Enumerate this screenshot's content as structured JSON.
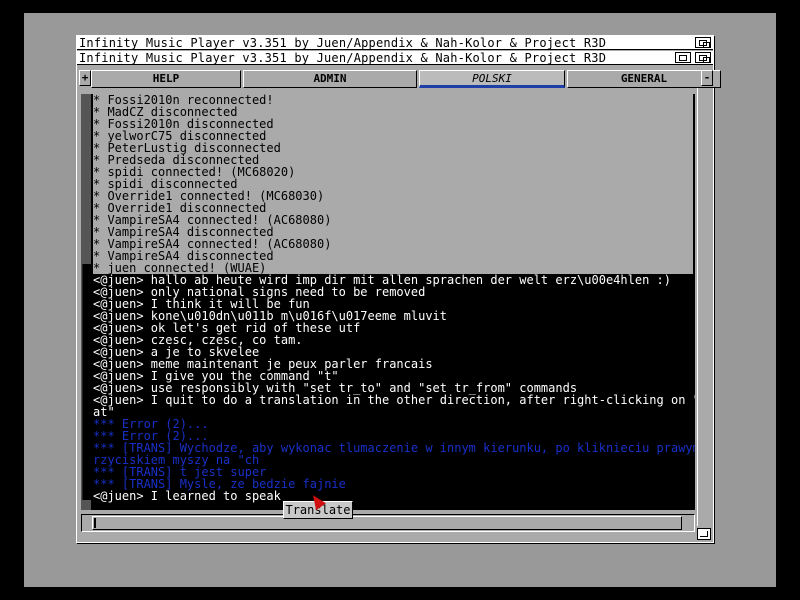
{
  "window": {
    "title": "Infinity Music Player v3.351 by Juen/Appendix & Nah-Kolor & Project R3D",
    "subtitle": "Infinity Music Player v3.351 by Juen/Appendix & Nah-Kolor & Project R3D"
  },
  "tabs": {
    "left_arrow": "+",
    "right_arrow": "-",
    "items": [
      {
        "label": "HELP"
      },
      {
        "label": "ADMIN"
      },
      {
        "label": "POLSKI"
      },
      {
        "label": "GENERAL"
      }
    ],
    "active": "POLSKI"
  },
  "log": {
    "lines": [
      {
        "text": "* Fossi2010n reconnected!",
        "kind": "sys"
      },
      {
        "text": "* MadCZ disconnected",
        "kind": "sys"
      },
      {
        "text": "* Fossi2010n disconnected",
        "kind": "sys"
      },
      {
        "text": "* yelworC75 disconnected",
        "kind": "sys"
      },
      {
        "text": "* PeterLustig disconnected",
        "kind": "sys"
      },
      {
        "text": "* Predseda disconnected",
        "kind": "sys"
      },
      {
        "text": "* spidi connected! (MC68020)",
        "kind": "sys"
      },
      {
        "text": "* spidi disconnected",
        "kind": "sys"
      },
      {
        "text": "* Override1 connected! (MC68030)",
        "kind": "sys"
      },
      {
        "text": "* Override1 disconnected",
        "kind": "sys"
      },
      {
        "text": "* VampireSA4 connected! (AC68080)",
        "kind": "sys"
      },
      {
        "text": "* VampireSA4 disconnected",
        "kind": "sys"
      },
      {
        "text": "* VampireSA4 connected! (AC68080)",
        "kind": "sys"
      },
      {
        "text": "* VampireSA4 disconnected",
        "kind": "sys"
      },
      {
        "text": "* juen connected! (WUAE)",
        "kind": "sys"
      },
      {
        "text": "<@juen> hallo ab heute wird imp dir mit allen sprachen der welt erz\\u00e4hlen :)",
        "kind": "user"
      },
      {
        "text": "<@juen> only national signs need to be removed",
        "kind": "user"
      },
      {
        "text": "<@juen> I think it will be fun",
        "kind": "user"
      },
      {
        "text": "<@juen> kone\\u010dn\\u011b m\\u016f\\u017eeme mluvit",
        "kind": "user"
      },
      {
        "text": "<@juen> ok let's get rid of these utf",
        "kind": "user"
      },
      {
        "text": "<@juen> czesc, czesc, co tam.",
        "kind": "user"
      },
      {
        "text": "<@juen> a je to skvelee",
        "kind": "user"
      },
      {
        "text": "<@juen> meme maintenant je peux parler francais",
        "kind": "user"
      },
      {
        "text": "<@juen> I give you the command \"t\"",
        "kind": "user"
      },
      {
        "text": "<@juen> use responsibly with \"set tr_to\" and \"set tr_from\" commands",
        "kind": "user"
      },
      {
        "text": "<@juen> I quit to do a translation in the other direction, after right-clicking on \"ch",
        "kind": "user"
      },
      {
        "text": "at\"",
        "kind": "user"
      },
      {
        "text": "*** Error (2)...",
        "kind": "err"
      },
      {
        "text": "*** Error (2)...",
        "kind": "err"
      },
      {
        "text": "*** [TRANS] Wychodze, aby wykonac tlumaczenie w innym kierunku, po kliknieciu prawym p",
        "kind": "err"
      },
      {
        "text": "rzyciskiem myszy na \"ch",
        "kind": "err"
      },
      {
        "text": "*** [TRANS] t jest super",
        "kind": "err"
      },
      {
        "text": "*** [TRANS] Mysle, ze bedzie fajnie",
        "kind": "err"
      },
      {
        "text": "<@juen> I learned to speak",
        "kind": "user"
      }
    ]
  },
  "input": {
    "value": ""
  },
  "tooltip": {
    "label": "Translate"
  },
  "colors": {
    "background": "#999999",
    "window": "#aaaaaa",
    "log_bg": "#000000",
    "system_text": "#000000",
    "user_text": "#ffffff",
    "error_text": "#1830c8",
    "active_tab_underline": "#1f3fa8"
  }
}
